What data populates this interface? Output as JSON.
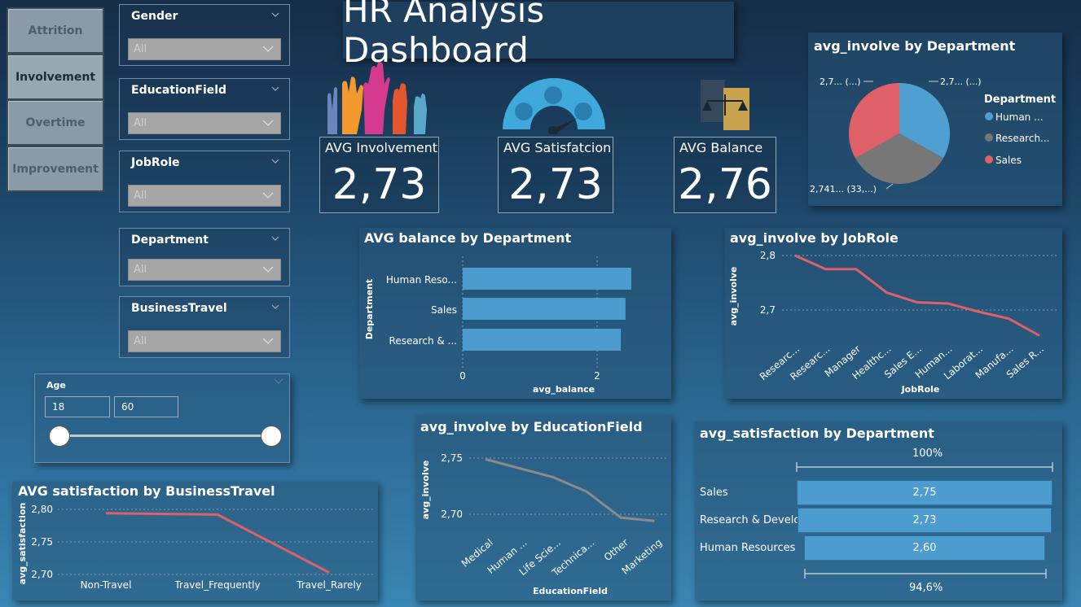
{
  "nav": {
    "buttons": [
      {
        "label": "Attrition",
        "active": false
      },
      {
        "label": "Involvement",
        "active": true
      },
      {
        "label": "Overtime",
        "active": false
      },
      {
        "label": "Improvement",
        "active": false
      }
    ]
  },
  "slicers": [
    {
      "title": "Gender",
      "value": "All"
    },
    {
      "title": "EducationField",
      "value": "All"
    },
    {
      "title": "JobRole",
      "value": "All"
    },
    {
      "title": "Department",
      "value": "All"
    },
    {
      "title": "BusinessTravel",
      "value": "All"
    }
  ],
  "age_slicer": {
    "title": "Age",
    "min": "18",
    "max": "60"
  },
  "header": {
    "title": "HR Analysis Dashboard"
  },
  "kpis": [
    {
      "label": "AVG Involvement",
      "value": "2,73"
    },
    {
      "label": "AVG Satisfatcion",
      "value": "2,73"
    },
    {
      "label": "AVG Balance",
      "value": "2,76"
    }
  ],
  "colors": {
    "bar": "#4d9ccf",
    "line": "#e0606a",
    "line_gray": "#8b8b8b",
    "pie_blue": "#4f9fd0",
    "pie_gray": "#777777",
    "pie_red": "#e0606a"
  },
  "charts": {
    "pie": {
      "title": "avg_involve by Department",
      "legend_title": "Department",
      "legend": [
        "Human ...",
        "Research...",
        "Sales"
      ],
      "labels": [
        "2,7... (...)",
        "2,741... (33,...)",
        "2,7... (...)"
      ]
    },
    "balance": {
      "title": "AVG balance by Department",
      "ylabel": "Department",
      "xlabel": "avg_balance",
      "ticks": [
        "0",
        "2"
      ]
    },
    "jobrole": {
      "title": "avg_involve by JobRole",
      "ylabel": "avg_involve",
      "xlabel": "JobRole",
      "yticks": [
        "2,8",
        "2,7"
      ]
    },
    "edu": {
      "title": "avg_involve by EducationField",
      "ylabel": "avg_involve",
      "xlabel": "EducationField",
      "yticks": [
        "2,75",
        "2,70"
      ]
    },
    "sat_dept": {
      "title": "avg_satisfaction by Department",
      "top_pct": "100%",
      "bottom_pct": "94,6%"
    },
    "travel": {
      "title": "AVG satisfaction by BusinessTravel",
      "ylabel": "avg_satisfaction",
      "yticks": [
        "2,80",
        "2,75",
        "2,70"
      ]
    }
  },
  "chart_data": [
    {
      "type": "pie",
      "title": "avg_involve by Department",
      "categories": [
        "Human ...",
        "Research...",
        "Sales"
      ],
      "values": [
        2.7,
        2.741,
        2.7
      ]
    },
    {
      "type": "bar",
      "title": "AVG balance by Department",
      "categories": [
        "Human Reso...",
        "Sales",
        "Research & ..."
      ],
      "values": [
        2.9,
        2.8,
        2.72
      ],
      "xlabel": "avg_balance",
      "ylabel": "Department",
      "xlim": [
        0,
        3.0
      ]
    },
    {
      "type": "line",
      "title": "avg_involve by JobRole",
      "categories": [
        "Researc...",
        "Researc...",
        "Manager",
        "Healthc...",
        "Sales E...",
        "Human...",
        "Laborat...",
        "Manufa...",
        "Sales R..."
      ],
      "values": [
        2.8,
        2.775,
        2.775,
        2.732,
        2.714,
        2.712,
        2.697,
        2.684,
        2.653
      ],
      "xlabel": "JobRole",
      "ylabel": "avg_involve",
      "ylim": [
        2.63,
        2.8
      ]
    },
    {
      "type": "line",
      "title": "avg_involve by EducationField",
      "categories": [
        "Medical",
        "Human ...",
        "Life Scie...",
        "Technica...",
        "Other",
        "Marketing"
      ],
      "values": [
        2.749,
        2.741,
        2.733,
        2.72,
        2.697,
        2.694
      ],
      "xlabel": "EducationField",
      "ylabel": "avg_involve",
      "ylim": [
        2.69,
        2.75
      ]
    },
    {
      "type": "bar",
      "title": "avg_satisfaction by Department",
      "categories": [
        "Sales",
        "Research & Develop...",
        "Human Resources"
      ],
      "values": [
        2.75,
        2.73,
        2.6
      ],
      "labels": [
        "2,75",
        "2,73",
        "2,60"
      ]
    },
    {
      "type": "line",
      "title": "AVG satisfaction by BusinessTravel",
      "categories": [
        "Non-Travel",
        "Travel_Frequently",
        "Travel_Rarely"
      ],
      "values": [
        2.794,
        2.792,
        2.703
      ],
      "ylabel": "avg_satisfaction",
      "ylim": [
        2.7,
        2.8
      ]
    }
  ]
}
